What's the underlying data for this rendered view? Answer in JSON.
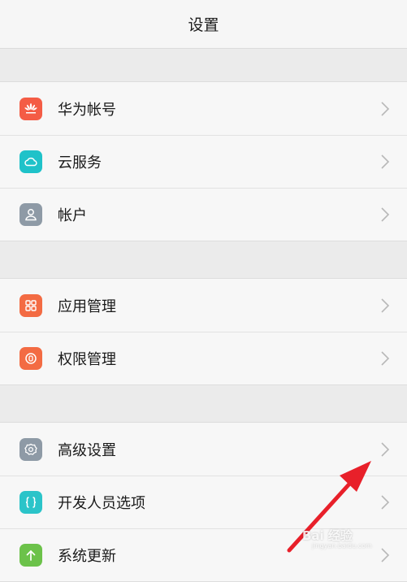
{
  "header": {
    "title": "设置"
  },
  "groups": [
    {
      "items": [
        {
          "label": "华为帐号",
          "icon": "huawei-logo-icon",
          "color": "#f45c45"
        },
        {
          "label": "云服务",
          "icon": "cloud-icon",
          "color": "#1fc2c9"
        },
        {
          "label": "帐户",
          "icon": "user-icon",
          "color": "#8e9aa6"
        }
      ]
    },
    {
      "items": [
        {
          "label": "应用管理",
          "icon": "app-grid-icon",
          "color": "#f36b43"
        },
        {
          "label": "权限管理",
          "icon": "permission-lock-icon",
          "color": "#f36b43"
        }
      ]
    },
    {
      "items": [
        {
          "label": "高级设置",
          "icon": "gear-icon",
          "color": "#8e9aa6"
        },
        {
          "label": "开发人员选项",
          "icon": "braces-icon",
          "color": "#2bc4c9"
        },
        {
          "label": "系统更新",
          "icon": "upload-arrow-icon",
          "color": "#6cc24a"
        }
      ]
    }
  ],
  "annotation": {
    "color": "#e8202a"
  },
  "watermark": {
    "text": "Bai 经验",
    "sub": "jingyan.baidu.com"
  }
}
